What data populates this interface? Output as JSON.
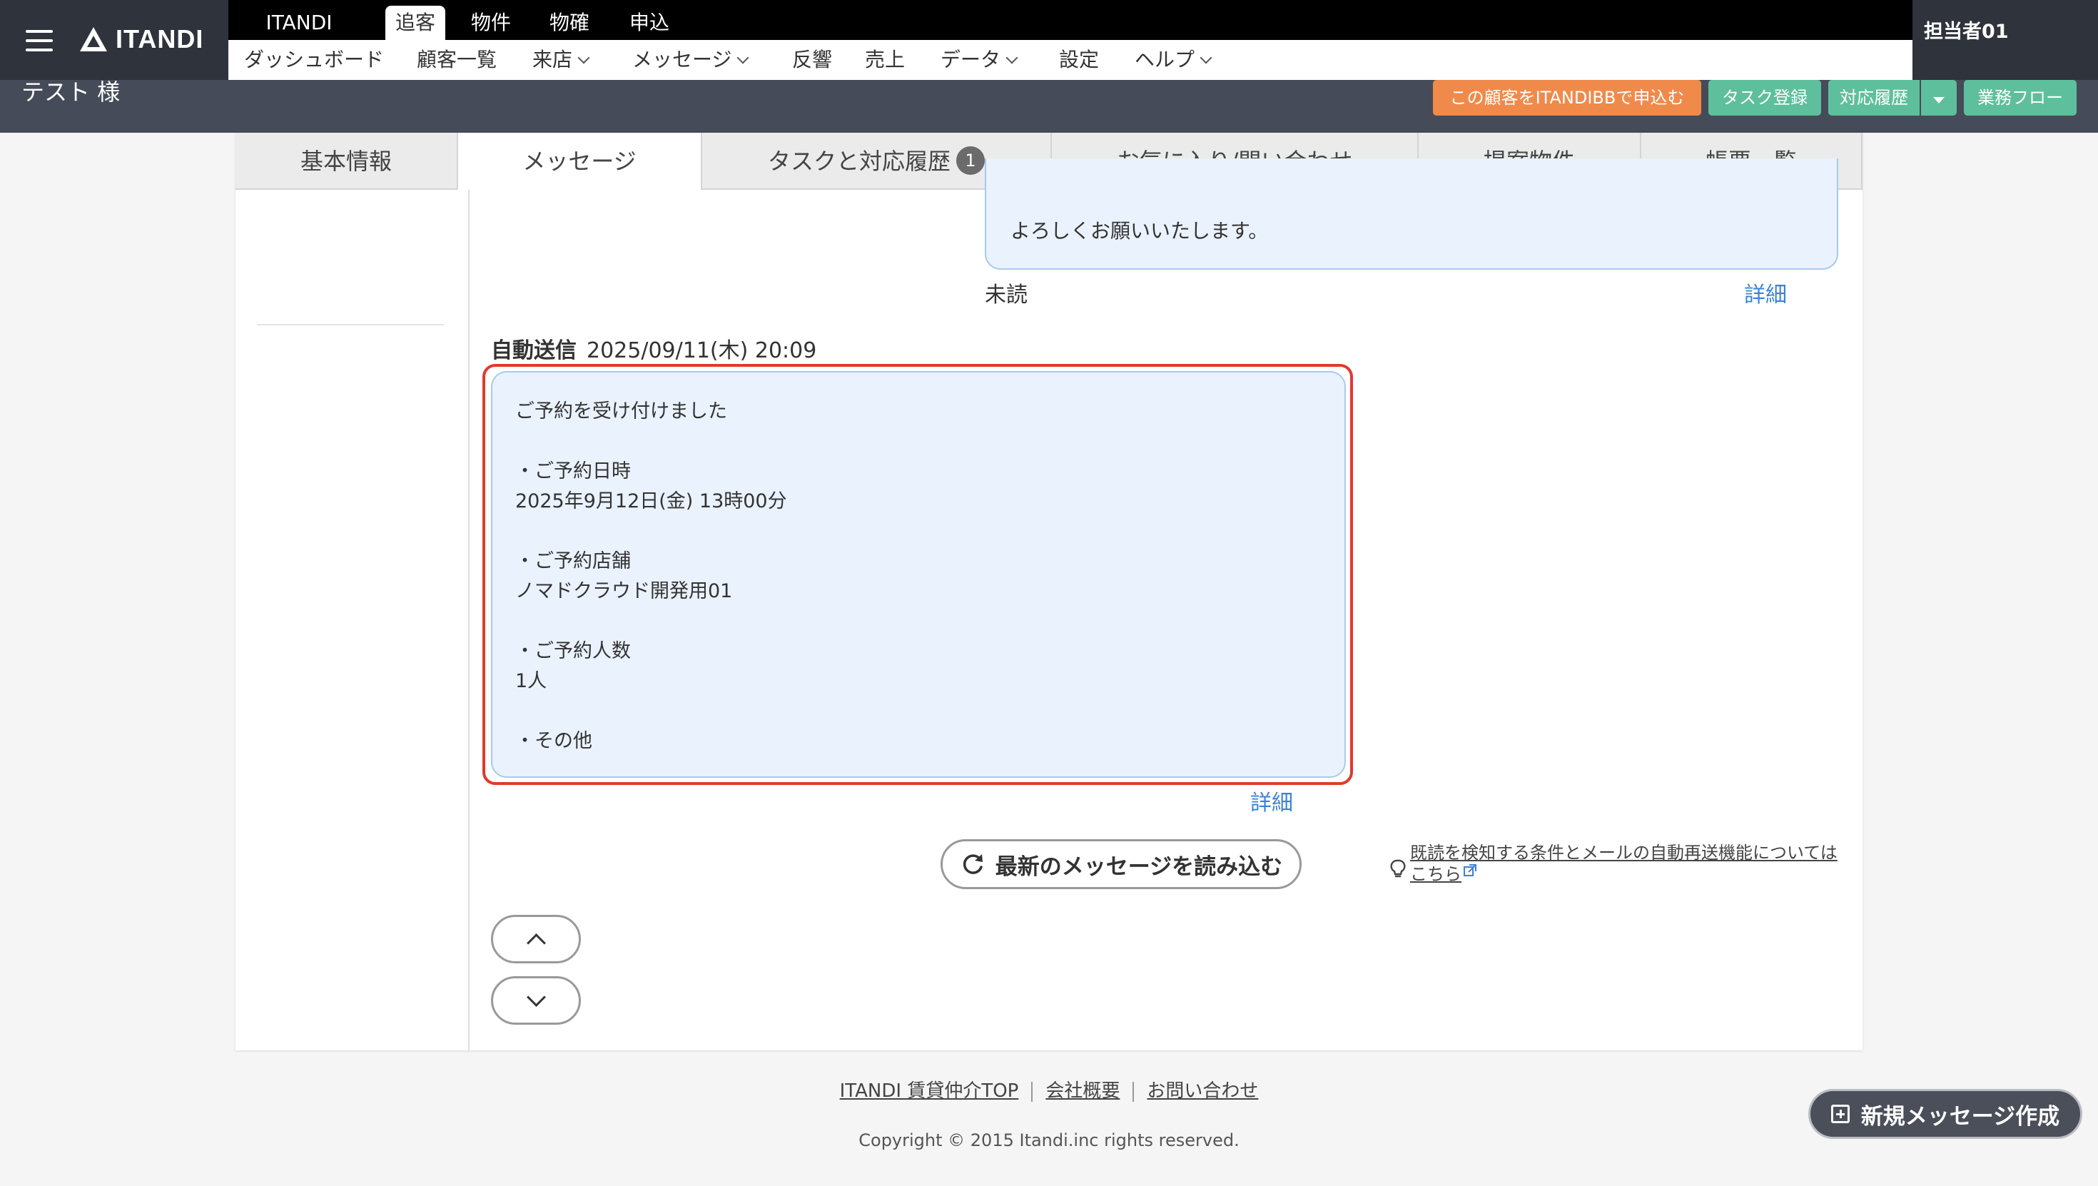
{
  "header": {
    "logo_text": "ITANDI",
    "main_tabs": [
      "ITANDI BB",
      "追客",
      "物件",
      "物確",
      "申込"
    ],
    "active_tab": "追客",
    "sub_nav": [
      "ダッシュボード",
      "顧客一覧",
      "来店",
      "メッセージ",
      "反響",
      "売上",
      "データ",
      "設定",
      "ヘルプ"
    ],
    "user_name": "担当者01",
    "customer_name": "テスト 様",
    "actions": {
      "apply": "この顧客をITANDIBBで申込む",
      "task_register": "タスク登録",
      "history": "対応履歴",
      "workflow": "業務フロー"
    }
  },
  "tabs": [
    "基本情報",
    "メッセージ",
    "タスクと対応履歴",
    "お気に入り/問い合わせ",
    "提案物件",
    "帳票一覧"
  ],
  "active_tab": "メッセージ",
  "task_badge": "1",
  "messages": {
    "previous": {
      "text": "よろしくお願いいたします。",
      "status": "未読",
      "detail": "詳細"
    },
    "auto": {
      "label": "自動送信",
      "timestamp": "2025/09/11(木) 20:09",
      "body": "ご予約を受け付けました\n\n・ご予約日時\n2025年9月12日(金) 13時00分\n\n・ご予約店舗\nノマドクラウド開発用01\n\n・ご予約人数\n1人\n\n・その他",
      "detail": "詳細"
    }
  },
  "reload_button": "最新のメッセージを読み込む",
  "note": {
    "line1": "既読を検知する条件とメールの自動再送機能については",
    "line2": "こちら"
  },
  "footer": {
    "links": [
      "ITANDI 賃貸仲介TOP",
      "会社概要",
      "お問い合わせ"
    ],
    "copyright": "Copyright © 2015 Itandi.inc rights reserved."
  },
  "new_message_button": "新規メッセージ作成",
  "colors": {
    "header_bg": "#454b58",
    "accent_orange": "#f08a4b",
    "accent_green": "#5ebf9c",
    "bubble_bg": "#eaf2fd",
    "highlight_red": "#e2392c",
    "link_blue": "#3b82d6"
  }
}
